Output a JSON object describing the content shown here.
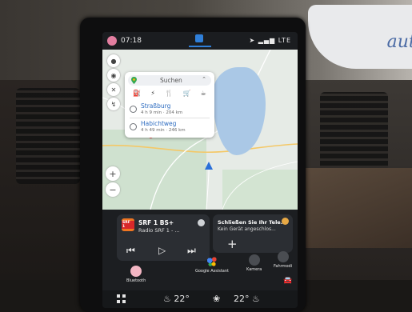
{
  "background": {
    "sign_text": "auto"
  },
  "status_bar": {
    "time": "07:18",
    "signal": "LTE"
  },
  "search": {
    "label": "Suchen",
    "categories": [
      "gas-station-icon",
      "charging-icon",
      "restaurant-icon",
      "shopping-icon",
      "cafe-icon"
    ]
  },
  "recent_destinations": [
    {
      "name": "Straßburg",
      "meta": "4 h 9 min · 204 km"
    },
    {
      "name": "Habichtweg",
      "meta": "4 h 49 min · 246 km"
    }
  ],
  "media": {
    "station_title": "SRF 1 BS+",
    "station_subtitle": "Radio SRF 1 - ...",
    "logo_text": "SRF 1"
  },
  "notification": {
    "title": "Schließen Sie Ihr Tele...",
    "subtitle": "Kein Gerät angeschlos..."
  },
  "apps": {
    "google_assistant": "Google Assistant",
    "camera": "Kamera",
    "driver_mode": "Fahrmodi",
    "bluetooth": "Bluetooth"
  },
  "climate": {
    "left_temp": "22°",
    "right_temp": "22°"
  },
  "colors": {
    "accent": "#2f7fd9",
    "srf_orange": "#f07622",
    "bluetooth_pink": "#f3b6c3"
  }
}
